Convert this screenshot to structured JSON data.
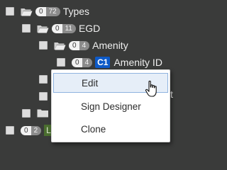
{
  "tree": [
    {
      "level": 0,
      "count_a": "0",
      "count_b": "72",
      "label": "Types",
      "folder": "open"
    },
    {
      "level": 1,
      "count_a": "0",
      "count_b": "11",
      "label": "EGD",
      "folder": "open"
    },
    {
      "level": 2,
      "count_a": "0",
      "count_b": "4",
      "label": "Amenity",
      "folder": "open"
    },
    {
      "level": 3,
      "count_a": "0",
      "count_b": "4",
      "chip": "C1",
      "label": "Amenity ID"
    }
  ],
  "partial_rows": {
    "hidden_suffix": "t",
    "last": {
      "count_a": "0",
      "count_b": "2",
      "label_fragment": "L"
    }
  },
  "context_menu": {
    "items": [
      "Edit",
      "Sign Designer",
      "Clone"
    ],
    "hovered": "Edit"
  },
  "colors": {
    "background": "#3a3b3a",
    "chip": "#0d5ac8",
    "menu_hover": "#e6eef8",
    "menu_hover_border": "#8fb3df"
  }
}
